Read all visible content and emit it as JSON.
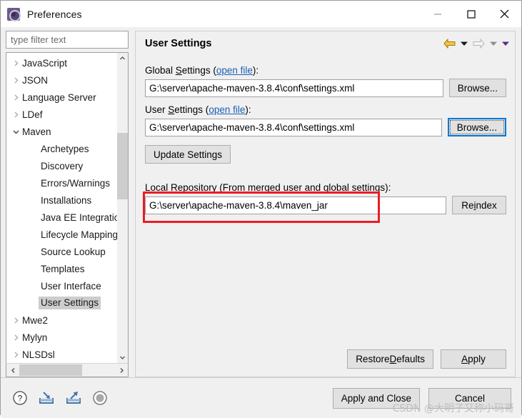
{
  "window": {
    "title": "Preferences",
    "icon": "preferences-gear-icon",
    "controls": {
      "minimize": "minimize-icon",
      "maximize": "maximize-icon",
      "close": "close-icon"
    }
  },
  "sidebar": {
    "filter": {
      "placeholder": "type filter text",
      "value": ""
    },
    "items": [
      {
        "label": "JavaScript",
        "level": 1,
        "state": "collapsed",
        "selected": false
      },
      {
        "label": "JSON",
        "level": 1,
        "state": "collapsed",
        "selected": false
      },
      {
        "label": "Language Server",
        "level": 1,
        "state": "collapsed",
        "selected": false
      },
      {
        "label": "LDef",
        "level": 1,
        "state": "collapsed",
        "selected": false
      },
      {
        "label": "Maven",
        "level": 1,
        "state": "expanded",
        "selected": false
      },
      {
        "label": "Archetypes",
        "level": 2,
        "state": "leaf",
        "selected": false
      },
      {
        "label": "Discovery",
        "level": 2,
        "state": "leaf",
        "selected": false
      },
      {
        "label": "Errors/Warnings",
        "level": 2,
        "state": "leaf",
        "selected": false
      },
      {
        "label": "Installations",
        "level": 2,
        "state": "leaf",
        "selected": false
      },
      {
        "label": "Java EE Integration",
        "level": 2,
        "state": "leaf",
        "selected": false
      },
      {
        "label": "Lifecycle Mappings",
        "level": 2,
        "state": "leaf",
        "selected": false
      },
      {
        "label": "Source Lookup",
        "level": 2,
        "state": "leaf",
        "selected": false
      },
      {
        "label": "Templates",
        "level": 2,
        "state": "leaf",
        "selected": false
      },
      {
        "label": "User Interface",
        "level": 2,
        "state": "leaf",
        "selected": false
      },
      {
        "label": "User Settings",
        "level": 2,
        "state": "leaf",
        "selected": true
      },
      {
        "label": "Mwe2",
        "level": 1,
        "state": "collapsed",
        "selected": false
      },
      {
        "label": "Mylyn",
        "level": 1,
        "state": "collapsed",
        "selected": false
      },
      {
        "label": "NLSDsl",
        "level": 1,
        "state": "collapsed",
        "selected": false
      }
    ]
  },
  "page": {
    "title": "User Settings",
    "nav": {
      "back": "back-arrow-icon",
      "back_menu": "back-dropdown-icon",
      "forward": "forward-arrow-icon",
      "forward_menu": "forward-dropdown-icon",
      "view_menu": "view-menu-dropdown-icon"
    },
    "global_settings": {
      "label_prefix": "Global ",
      "label_mnemonic": "S",
      "label_rest": "ettings (",
      "link": "open file",
      "label_suffix": "):",
      "value": "G:\\server\\apache-maven-3.8.4\\conf\\settings.xml",
      "browse_label_pre": "Browse",
      "browse_label": "Browse..."
    },
    "user_settings": {
      "label_prefix": "User ",
      "label_mnemonic": "S",
      "label_rest": "ettings (",
      "link": "open file",
      "label_suffix": "):",
      "value": "G:\\server\\apache-maven-3.8.4\\conf\\settings.xml",
      "browse_label": "Browse...",
      "focused": true
    },
    "update_settings_label": "Update Settings",
    "local_repository": {
      "label": "Local Repository (From merged user and global settings):",
      "value": "G:\\server\\apache-maven-3.8.4\\maven_jar",
      "reindex_pre": "Re",
      "reindex_mnemonic": "i",
      "reindex_post": "ndex",
      "annotation_color": "#ec1c24"
    },
    "restore_defaults": {
      "pre": "Restore ",
      "mnemonic": "D",
      "post": "efaults"
    },
    "apply": {
      "pre": "",
      "mnemonic": "A",
      "post": "pply"
    }
  },
  "footer": {
    "icons": [
      {
        "name": "help-icon",
        "title": "Help"
      },
      {
        "name": "import-icon",
        "title": "Import"
      },
      {
        "name": "export-icon",
        "title": "Export"
      },
      {
        "name": "record-icon",
        "title": "Record"
      }
    ],
    "apply_and_close": "Apply and Close",
    "cancel": "Cancel"
  },
  "watermark": "CSDN @大明子又称小码哥"
}
